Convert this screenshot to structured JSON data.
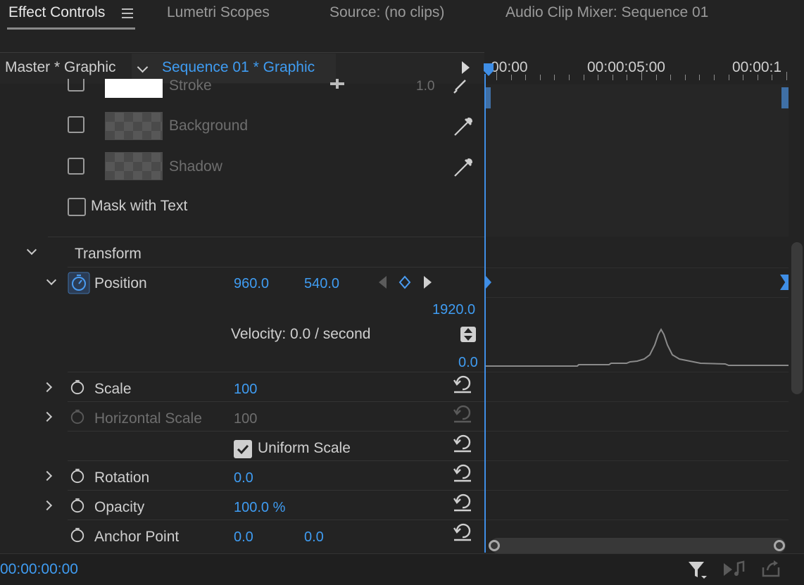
{
  "tabs": [
    {
      "label": "Effect Controls",
      "active": true
    },
    {
      "label": "Lumetri Scopes",
      "active": false
    },
    {
      "label": "Source: (no clips)",
      "active": false
    },
    {
      "label": "Audio Clip Mixer: Sequence 01",
      "active": false
    }
  ],
  "header": {
    "master": "Master * Graphic",
    "sequence": "Sequence 01 * Graphic"
  },
  "ruler": {
    "t0": "00:00",
    "t1": "00:00:05:00",
    "t2": "00:00:1"
  },
  "appearance": {
    "stroke_label": "Stroke",
    "stroke_value": "1.0",
    "background_label": "Background",
    "shadow_label": "Shadow",
    "mask_label": "Mask with Text"
  },
  "transform": {
    "section_label": "Transform",
    "position_label": "Position",
    "position_x": "960.0",
    "position_y": "540.0",
    "graph_max": "1920.0",
    "velocity": "Velocity: 0.0 / second",
    "graph_min": "0.0",
    "scale_label": "Scale",
    "scale_value": "100",
    "hscale_label": "Horizontal Scale",
    "hscale_value": "100",
    "uniform_label": "Uniform Scale",
    "uniform_checked": true,
    "rotation_label": "Rotation",
    "rotation_value": "0.0",
    "opacity_label": "Opacity",
    "opacity_value": "100.0 %",
    "anchor_label": "Anchor Point",
    "anchor_x": "0.0",
    "anchor_y": "0.0"
  },
  "footer": {
    "timecode": "00:00:00:00"
  },
  "colors": {
    "accent": "#3f9cf2",
    "background": "#232323"
  }
}
